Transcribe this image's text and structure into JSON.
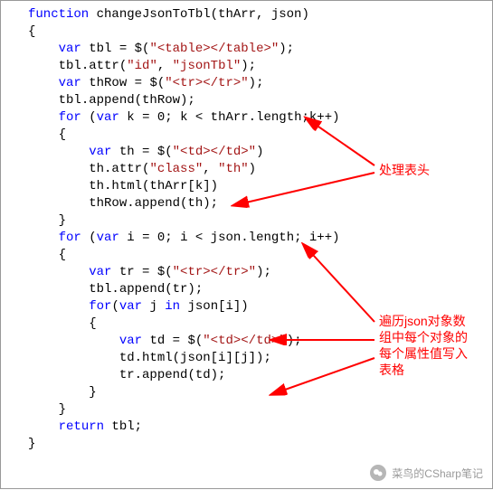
{
  "code": {
    "l1_kw1": "function",
    "l1_fn": " changeJsonToTbl",
    "l1_args": "(thArr, json)",
    "l2_brace": "{",
    "l3_indent": "    ",
    "l3_kw": "var",
    "l3_rest": " tbl = $(",
    "l3_str": "\"<table></table>\"",
    "l3_end": ");",
    "l4_indent": "    ",
    "l4_rest": "tbl.attr(",
    "l4_str1": "\"id\"",
    "l4_mid": ", ",
    "l4_str2": "\"jsonTbl\"",
    "l4_end": ");",
    "l5_indent": "    ",
    "l5_kw": "var",
    "l5_rest": " thRow = $(",
    "l5_str": "\"<tr></tr>\"",
    "l5_end": ");",
    "l6_indent": "    ",
    "l6_rest": "tbl.append(thRow);",
    "l7_indent": "    ",
    "l7_kw": "for",
    "l7_rest": " (",
    "l7_kw2": "var",
    "l7_rest2": " k = 0; k < thArr.length;k++)",
    "l8_indent": "    ",
    "l8_brace": "{",
    "l9_indent": "        ",
    "l9_kw": "var",
    "l9_rest": " th = $(",
    "l9_str": "\"<td></td>\"",
    "l9_end": ")",
    "l10_indent": "        ",
    "l10_rest": "th.attr(",
    "l10_str1": "\"class\"",
    "l10_mid": ", ",
    "l10_str2": "\"th\"",
    "l10_end": ")",
    "l11_indent": "        ",
    "l11_rest": "th.html(thArr[k])",
    "l12_indent": "        ",
    "l12_rest": "thRow.append(th);",
    "l13_indent": "    ",
    "l13_brace": "}",
    "l14_indent": "    ",
    "l14_kw": "for",
    "l14_rest": " (",
    "l14_kw2": "var",
    "l14_rest2": " i = 0; i < json.length; i++)",
    "l15_indent": "    ",
    "l15_brace": "{",
    "l16_indent": "        ",
    "l16_kw": "var",
    "l16_rest": " tr = $(",
    "l16_str": "\"<tr></tr>\"",
    "l16_end": ");",
    "l17_indent": "        ",
    "l17_rest": "tbl.append(tr);",
    "l18_indent": "        ",
    "l18_kw": "for",
    "l18_rest": "(",
    "l18_kw2": "var",
    "l18_rest2": " j ",
    "l18_kw3": "in",
    "l18_rest3": " json[i])",
    "l19_indent": "        ",
    "l19_brace": "{",
    "l20_indent": "            ",
    "l20_kw": "var",
    "l20_rest": " td = $(",
    "l20_str": "\"<td></td>\"",
    "l20_end": ");",
    "l21_indent": "            ",
    "l21_rest": "td.html(json[i][j]);",
    "l22_indent": "            ",
    "l22_rest": "tr.append(td);",
    "l23_indent": "        ",
    "l23_brace": "}",
    "l24_indent": "    ",
    "l24_brace": "}",
    "l25_indent": "    ",
    "l25_kw": "return",
    "l25_rest": " tbl;",
    "l26_brace": "}"
  },
  "annotations": {
    "a1": "处理表头",
    "a2": "遍历json对象数\n组中每个对象的\n每个属性值写入\n表格"
  },
  "watermark": {
    "text": "菜鸟的CSharp笔记"
  }
}
